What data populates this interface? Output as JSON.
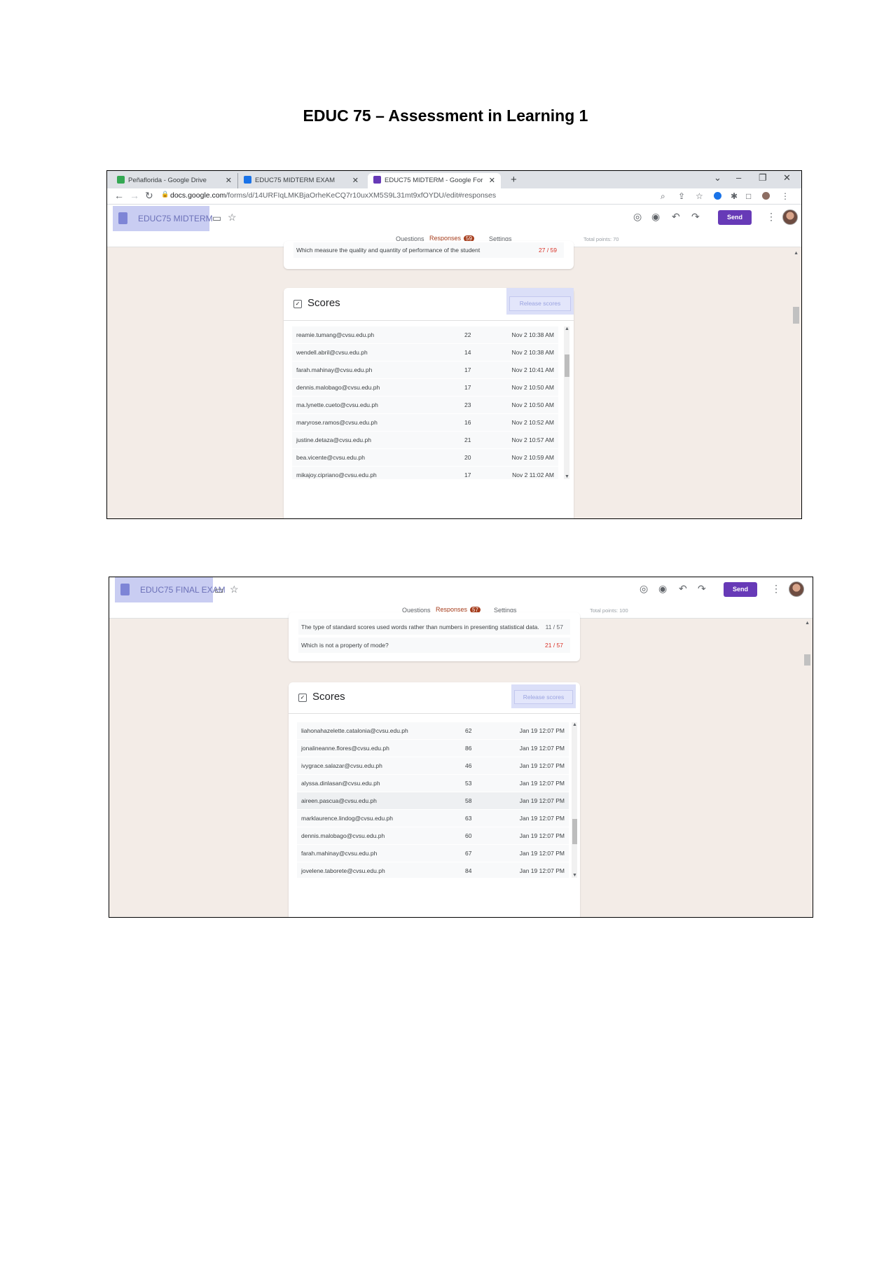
{
  "document": {
    "title": "EDUC 75 – Assessment in Learning 1"
  },
  "midterm": {
    "browser": {
      "tabs": [
        {
          "label": "Peñaflorida - Google Drive",
          "color": "#34a853"
        },
        {
          "label": "EDUC75 MIDTERM EXAM",
          "color": "#1a73e8"
        },
        {
          "label": "EDUC75 MIDTERM - Google For",
          "color": "#673ab7"
        }
      ],
      "new_tab": "+",
      "url_host": "docs.google.com",
      "url_path": "/forms/d/14URFIqLMKBjaOrheKeCQ7r10uxXM5S9L31mt9xfOYDU/edit#responses"
    },
    "form": {
      "doc_name": "EDUC75 MIDTERM",
      "send_label": "Send",
      "tabs": {
        "questions": "Questions",
        "responses": "Responses",
        "responses_count": "59",
        "settings": "Settings"
      },
      "total_points": "Total points: 70",
      "question": {
        "text": "Which measure the quality and quantity of performance of the student",
        "score": "27 / 59"
      },
      "scores_title": "Scores",
      "release_label": "Release scores",
      "responses": [
        {
          "email": "reamie.tumang@cvsu.edu.ph",
          "points": "22",
          "time": "Nov 2 10:38 AM"
        },
        {
          "email": "wendell.abril@cvsu.edu.ph",
          "points": "14",
          "time": "Nov 2 10:38 AM"
        },
        {
          "email": "farah.mahinay@cvsu.edu.ph",
          "points": "17",
          "time": "Nov 2 10:41 AM"
        },
        {
          "email": "dennis.malobago@cvsu.edu.ph",
          "points": "17",
          "time": "Nov 2 10:50 AM"
        },
        {
          "email": "ma.lynette.cueto@cvsu.edu.ph",
          "points": "23",
          "time": "Nov 2 10:50 AM"
        },
        {
          "email": "maryrose.ramos@cvsu.edu.ph",
          "points": "16",
          "time": "Nov 2 10:52 AM"
        },
        {
          "email": "justine.detaza@cvsu.edu.ph",
          "points": "21",
          "time": "Nov 2 10:57 AM"
        },
        {
          "email": "bea.vicente@cvsu.edu.ph",
          "points": "20",
          "time": "Nov 2 10:59 AM"
        },
        {
          "email": "mikajoy.cipriano@cvsu.edu.ph",
          "points": "17",
          "time": "Nov 2 11:02 AM"
        }
      ]
    }
  },
  "final": {
    "form": {
      "doc_name": "EDUC75 FINAL EXAM",
      "send_label": "Send",
      "tabs": {
        "questions": "Questions",
        "responses": "Responses",
        "responses_count": "57",
        "settings": "Settings"
      },
      "total_points": "Total points: 100",
      "questions": [
        {
          "text": "The type of standard scores used words rather than numbers in presenting statistical data.",
          "score": "11 / 57",
          "color": "grey"
        },
        {
          "text": "Which is not a property of mode?",
          "score": "21 / 57",
          "color": "red"
        }
      ],
      "scores_title": "Scores",
      "release_label": "Release scores",
      "responses": [
        {
          "email": "liahonahazelette.catalonia@cvsu.edu.ph",
          "points": "62",
          "time": "Jan 19 12:07 PM"
        },
        {
          "email": "jonalineanne.flores@cvsu.edu.ph",
          "points": "86",
          "time": "Jan 19 12:07 PM"
        },
        {
          "email": "ivygrace.salazar@cvsu.edu.ph",
          "points": "46",
          "time": "Jan 19 12:07 PM"
        },
        {
          "email": "alyssa.dinlasan@cvsu.edu.ph",
          "points": "53",
          "time": "Jan 19 12:07 PM"
        },
        {
          "email": "aireen.pascua@cvsu.edu.ph",
          "points": "58",
          "time": "Jan 19 12:07 PM"
        },
        {
          "email": "marklaurence.lindog@cvsu.edu.ph",
          "points": "63",
          "time": "Jan 19 12:07 PM"
        },
        {
          "email": "dennis.malobago@cvsu.edu.ph",
          "points": "60",
          "time": "Jan 19 12:07 PM"
        },
        {
          "email": "farah.mahinay@cvsu.edu.ph",
          "points": "67",
          "time": "Jan 19 12:07 PM"
        },
        {
          "email": "jovelene.taborete@cvsu.edu.ph",
          "points": "84",
          "time": "Jan 19 12:07 PM"
        }
      ]
    }
  },
  "colors": {
    "accent": "#673ab7",
    "responses_tab": "#a63d1c",
    "page_bg": "#f3ece7"
  }
}
